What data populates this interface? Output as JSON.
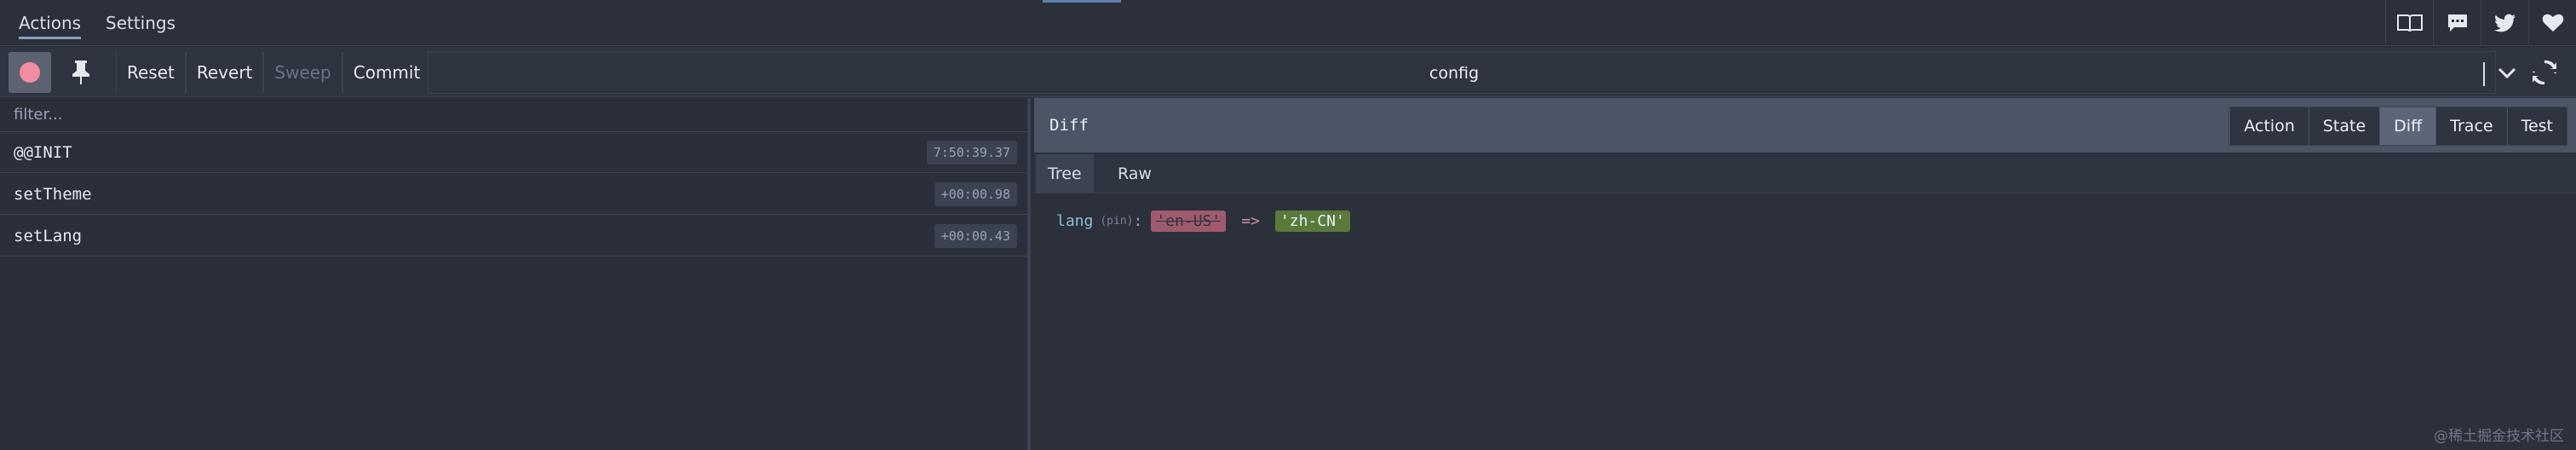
{
  "top_tabs": [
    {
      "label": "Actions",
      "active": true
    },
    {
      "label": "Settings",
      "active": false
    }
  ],
  "top_icons": [
    "book-icon",
    "chat-icon",
    "twitter-icon",
    "heart-icon"
  ],
  "toolbar": {
    "reset_label": "Reset",
    "revert_label": "Revert",
    "sweep_label": "Sweep",
    "commit_label": "Commit",
    "instance_value": "config"
  },
  "actions_list": {
    "filter_placeholder": "filter...",
    "items": [
      {
        "name": "@@INIT",
        "time": "7:50:39.37"
      },
      {
        "name": "setTheme",
        "time": "+00:00.98"
      },
      {
        "name": "setLang",
        "time": "+00:00.43"
      }
    ]
  },
  "inspector": {
    "title": "Diff",
    "modes": [
      "Action",
      "State",
      "Diff",
      "Trace",
      "Test"
    ],
    "active_mode": "Diff",
    "sub_tabs": [
      "Tree",
      "Raw"
    ],
    "active_sub_tab": "Tree",
    "diff": {
      "key": "lang",
      "pin": "(pin)",
      "colon": ":",
      "old_value": "'en-US'",
      "arrow": "=>",
      "new_value": "'zh-CN'"
    }
  },
  "watermark": "@稀土掘金技术社区",
  "colors": {
    "accent": "#81a1c1",
    "record": "#f08ea0",
    "removed_bg": "#a05a6e",
    "added_bg": "#5a7a3c",
    "key": "#88c0d0"
  }
}
